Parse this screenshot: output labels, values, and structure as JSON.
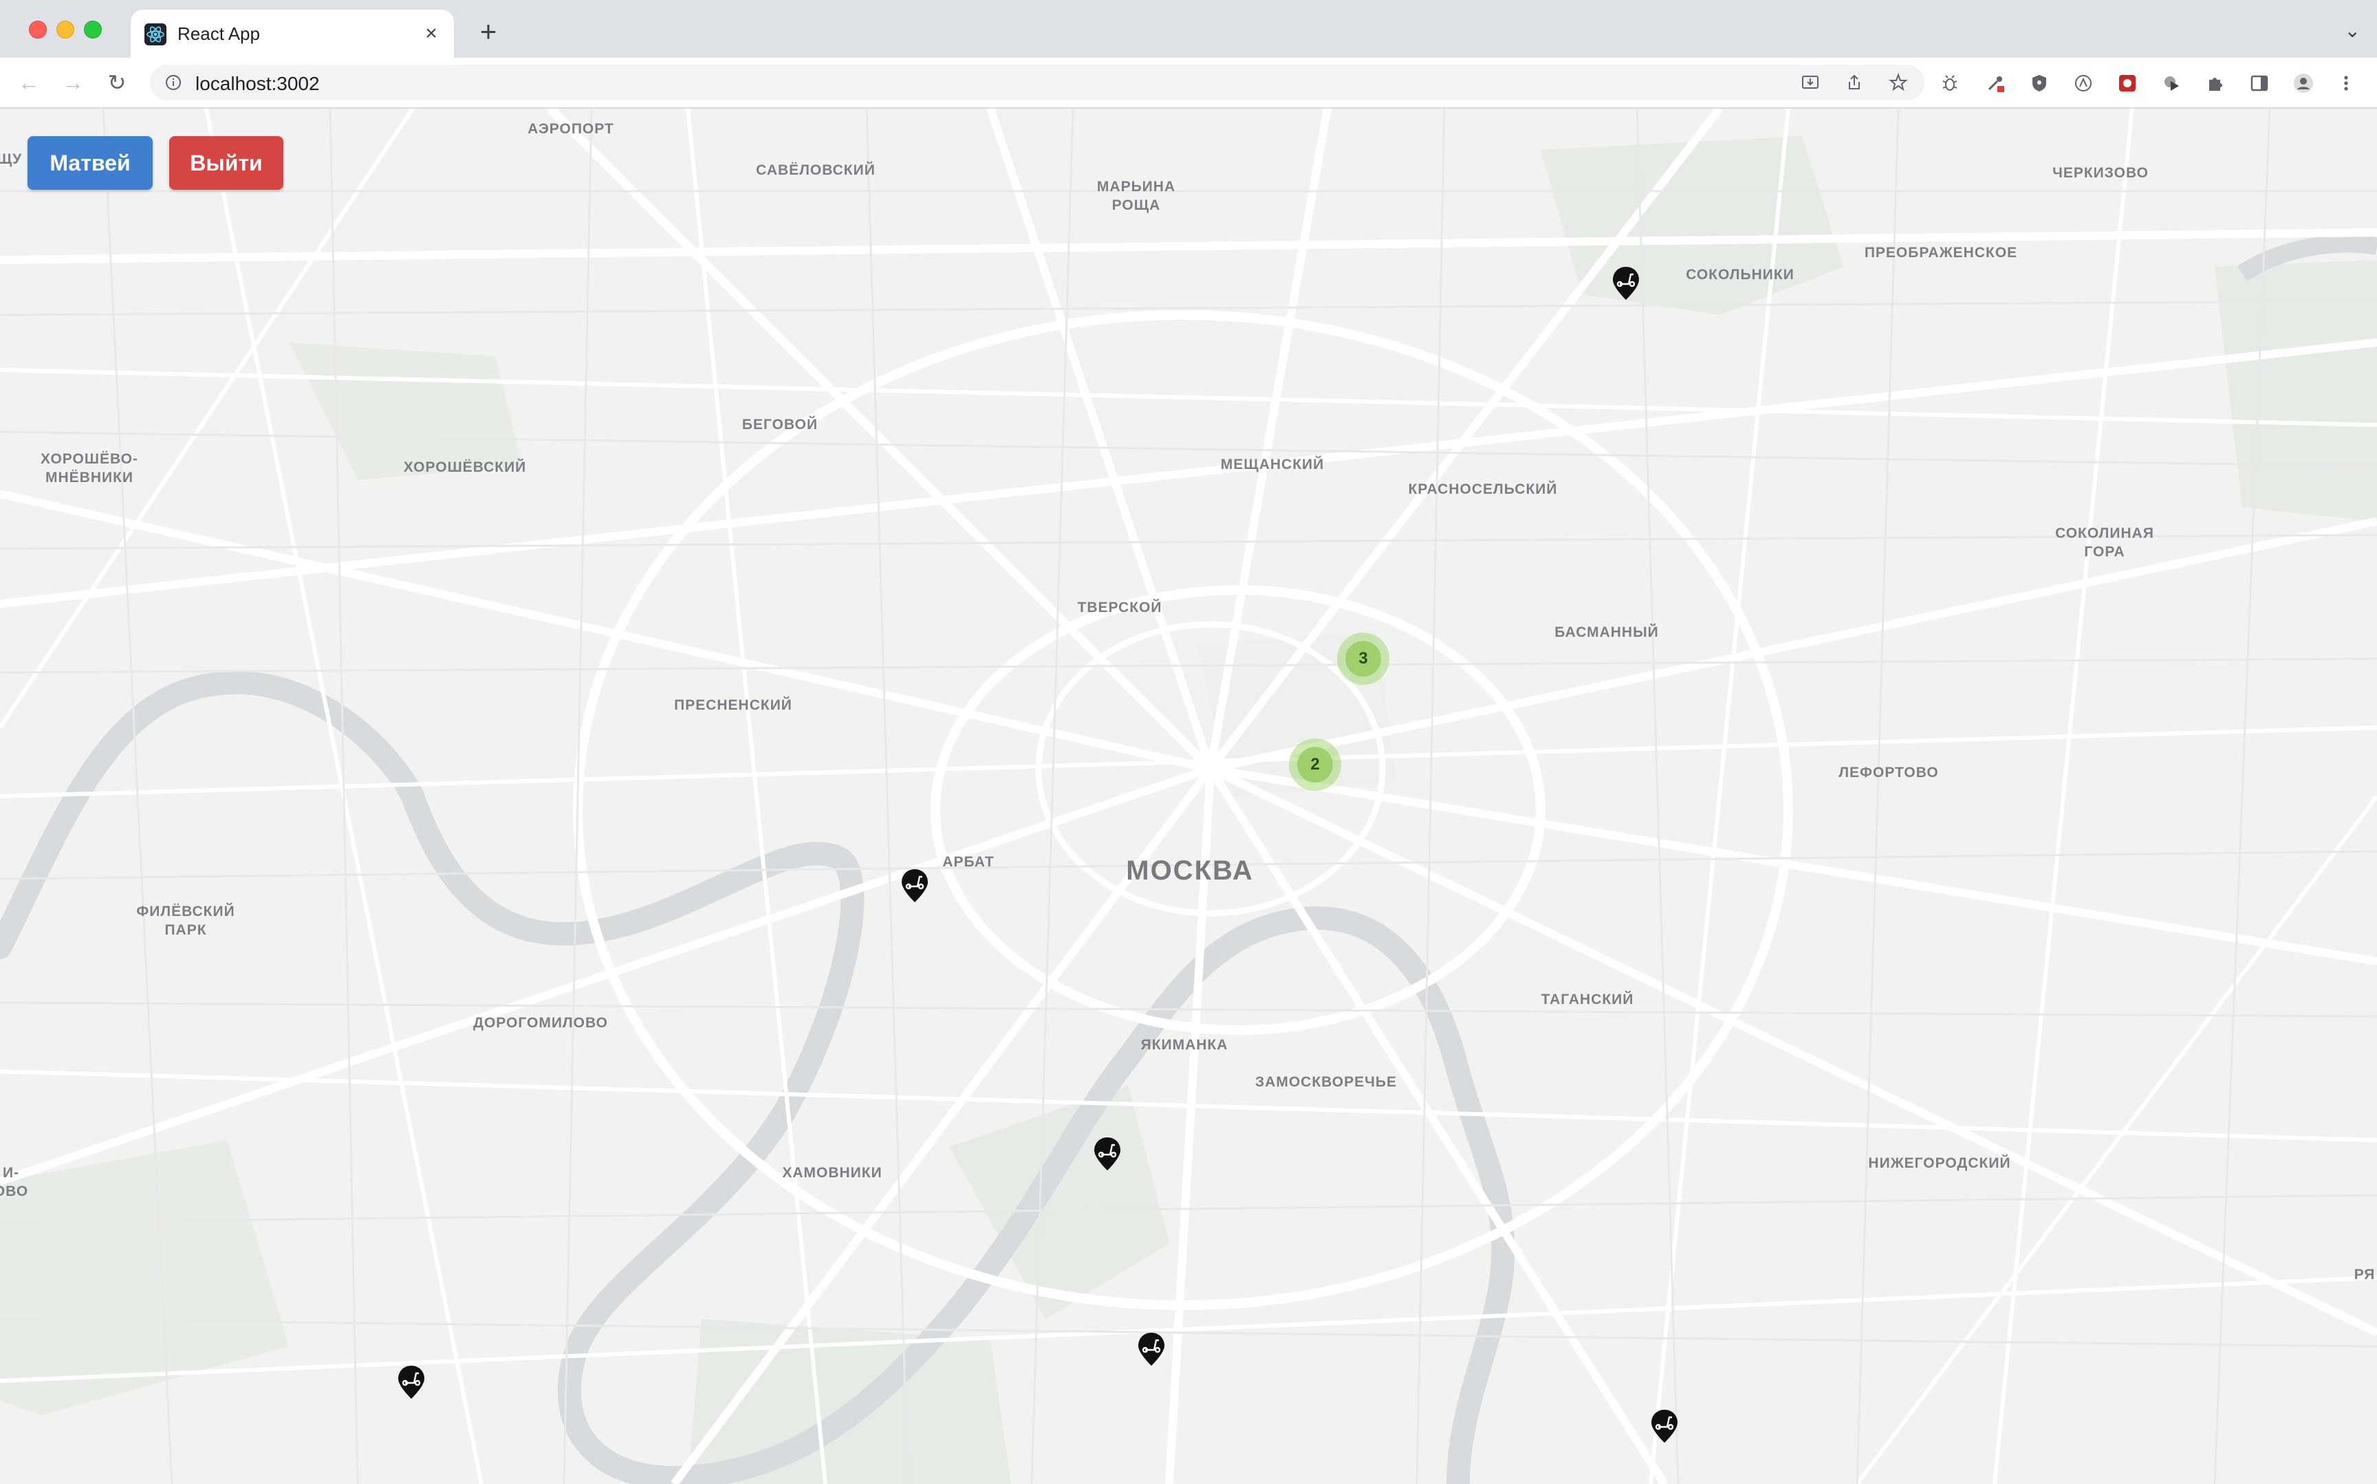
{
  "browser": {
    "tab_title": "React App",
    "tab_close_glyph": "×",
    "new_tab_glyph": "+",
    "tab_search_glyph": "⌄",
    "url": "localhost:3002",
    "back_glyph": "←",
    "forward_glyph": "→",
    "reload_glyph": "↻"
  },
  "app": {
    "user_button_label": "Матвей",
    "logout_button_label": "Выйти",
    "user_button_color": "#3f7fd2",
    "logout_button_color": "#d64541"
  },
  "map": {
    "city": "МОСКВА",
    "districts": [
      {
        "id": "aeroport",
        "label": "АЭРОПОРТ"
      },
      {
        "id": "savelovsky",
        "label": "САВЁЛОВСКИЙ"
      },
      {
        "id": "marina-roshcha",
        "label": "МАРЬИНА\nРОЩА"
      },
      {
        "id": "cherkizovo",
        "label": "ЧЕРКИЗОВО"
      },
      {
        "id": "sokolniki",
        "label": "СОКОЛЬНИКИ"
      },
      {
        "id": "preobrazhenskoe",
        "label": "ПРЕОБРАЖЕНСКОЕ"
      },
      {
        "id": "begovoy",
        "label": "БЕГОВОЙ"
      },
      {
        "id": "khoroshevo-mnevniki",
        "label": "ХОРОШЁВО-\nМНЁВНИКИ"
      },
      {
        "id": "khoroshevsky",
        "label": "ХОРОШЁВСКИЙ"
      },
      {
        "id": "meshchansky",
        "label": "МЕЩАНСКИЙ"
      },
      {
        "id": "krasnoselsky",
        "label": "КРАСНОСЕЛЬСКИЙ"
      },
      {
        "id": "sokolinaya-gora",
        "label": "СОКОЛИНАЯ\nГОРА"
      },
      {
        "id": "tverskoy",
        "label": "ТВЕРСКОЙ"
      },
      {
        "id": "basmanny",
        "label": "БАСМАННЫЙ"
      },
      {
        "id": "presnensky",
        "label": "ПРЕСНЕНСКИЙ"
      },
      {
        "id": "lefortovo",
        "label": "ЛЕФОРТОВО"
      },
      {
        "id": "arbat",
        "label": "АРБАТ"
      },
      {
        "id": "filevsky-park",
        "label": "ФИЛЁВСКИЙ\nПАРК"
      },
      {
        "id": "dorogomilovo",
        "label": "ДОРОГОМИЛОВО"
      },
      {
        "id": "tagansky",
        "label": "ТАГАНСКИЙ"
      },
      {
        "id": "yakimanka",
        "label": "ЯКИМАНКА"
      },
      {
        "id": "zamoskvorechye",
        "label": "ЗАМОСКВОРЕЧЬЕ"
      },
      {
        "id": "khamovniki",
        "label": "ХАМОВНИКИ"
      },
      {
        "id": "nizhegorodsky",
        "label": "НИЖЕГОРОДСКИЙ"
      },
      {
        "id": "edge-left-top",
        "label": "ЩУ"
      },
      {
        "id": "edge-left-bottom",
        "label": "И-\nОВО"
      },
      {
        "id": "edge-right-bottom",
        "label": "РЯ"
      }
    ],
    "clusters": [
      {
        "id": "cluster-1",
        "count": "3"
      },
      {
        "id": "cluster-2",
        "count": "2"
      }
    ],
    "scooter_markers": 6,
    "marker_icon": "scooter-icon",
    "cluster_color": "#9fd06c"
  }
}
